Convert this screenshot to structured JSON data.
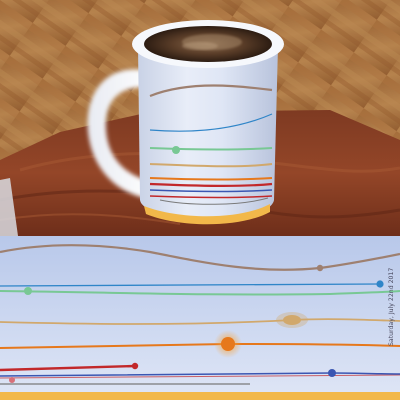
{
  "mug_design": {
    "date_text": "Saturday, July 22nd 2017",
    "background": {
      "top": "#b8c8ea",
      "bottom": "#dfe6f6"
    },
    "base_stripe": "#f2b84a",
    "lines": [
      {
        "name": "brown-wave",
        "color": "#9e8070"
      },
      {
        "name": "blue-line",
        "color": "#2f85c8"
      },
      {
        "name": "green-line",
        "color": "#78c894"
      },
      {
        "name": "tan-line",
        "color": "#d1a86c"
      },
      {
        "name": "orange-line",
        "color": "#e6781c"
      },
      {
        "name": "red-line",
        "color": "#c2282a"
      },
      {
        "name": "navy-line",
        "color": "#3a56b2"
      },
      {
        "name": "gray-line",
        "color": "#7a7a7a"
      }
    ]
  },
  "scene_colors": {
    "floor": "#b27a45",
    "table": "#8c3e24",
    "mug": "#f4f6fb",
    "coffee": "#3b2718"
  }
}
